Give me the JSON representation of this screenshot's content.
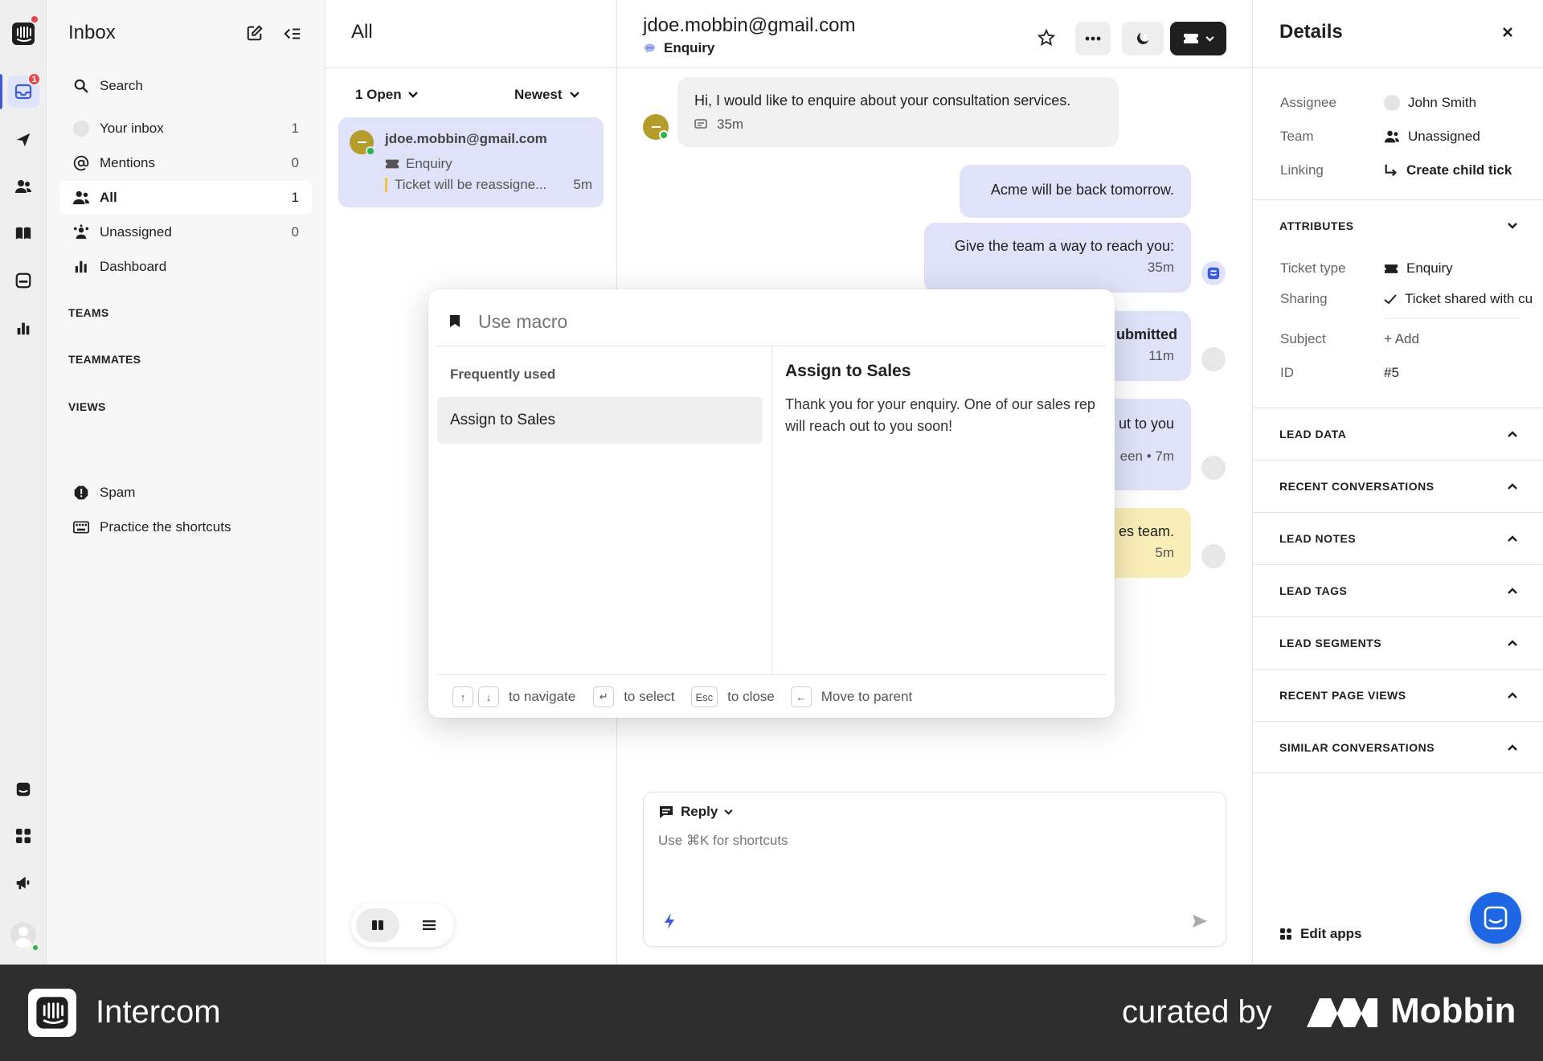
{
  "sidebar": {
    "title": "Inbox",
    "search_label": "Search",
    "items": [
      {
        "label": "Your inbox",
        "count": "1"
      },
      {
        "label": "Mentions",
        "count": "0"
      },
      {
        "label": "All",
        "count": "1"
      },
      {
        "label": "Unassigned",
        "count": "0"
      },
      {
        "label": "Dashboard",
        "count": ""
      }
    ],
    "sections": [
      "TEAMS",
      "TEAMMATES",
      "VIEWS"
    ],
    "bottom_items": [
      {
        "label": "Spam"
      },
      {
        "label": "Practice the shortcuts"
      }
    ],
    "notification_badge": "1"
  },
  "list": {
    "title": "All",
    "filter_label": "1 Open",
    "sort_label": "Newest",
    "conversation": {
      "email": "jdoe.mobbin@gmail.com",
      "type": "Enquiry",
      "preview": "Ticket will be reassigne...",
      "time": "5m"
    }
  },
  "conversation": {
    "title": "jdoe.mobbin@gmail.com",
    "subtitle": "Enquiry",
    "messages": [
      {
        "text": "Hi, I would like to enquire about your consultation services.",
        "time": "35m"
      },
      {
        "text": "Acme will be back tomorrow."
      },
      {
        "text": "Give the team a way to reach you:",
        "time": "35m"
      },
      {
        "text": "ubmitted",
        "time": "11m"
      },
      {
        "text": "ut to you",
        "time": "een • 7m"
      },
      {
        "text": "es team.",
        "time": "5m"
      }
    ],
    "composer": {
      "mode_label": "Reply",
      "placeholder": "Use ⌘K for shortcuts"
    }
  },
  "details": {
    "title": "Details",
    "rows": [
      {
        "label": "Assignee",
        "value": "John Smith"
      },
      {
        "label": "Team",
        "value": "Unassigned"
      },
      {
        "label": "Linking",
        "value": "Create child tick"
      }
    ],
    "attributes_title": "ATTRIBUTES",
    "attributes": [
      {
        "label": "Ticket type",
        "value": "Enquiry"
      },
      {
        "label": "Sharing",
        "value": "Ticket shared with cu"
      },
      {
        "label": "Subject",
        "value": "+ Add"
      },
      {
        "label": "ID",
        "value": "#5"
      }
    ],
    "sections": [
      "LEAD DATA",
      "RECENT CONVERSATIONS",
      "LEAD NOTES",
      "LEAD TAGS",
      "LEAD SEGMENTS",
      "RECENT PAGE VIEWS",
      "SIMILAR CONVERSATIONS"
    ],
    "edit_apps_label": "Edit apps"
  },
  "macro": {
    "search_placeholder": "Use macro",
    "group_label": "Frequently used",
    "items": [
      "Assign to Sales"
    ],
    "preview_title": "Assign to Sales",
    "preview_body": "Thank you for your enquiry. One of our sales rep will reach out to you soon!",
    "hints": {
      "navigate": "to navigate",
      "select": "to select",
      "esc_key": "Esc",
      "close": "to close",
      "parent": "Move to parent"
    }
  },
  "footer": {
    "brand": "Intercom",
    "curated_by": "curated by",
    "curator": "Mobbin"
  },
  "colors": {
    "accent": "#3b5bdb",
    "outgoing_bubble": "#dfe2f8",
    "note_bubble": "#faeeb8",
    "badge": "#e5484d",
    "footer_bg": "#2d2d2d"
  }
}
